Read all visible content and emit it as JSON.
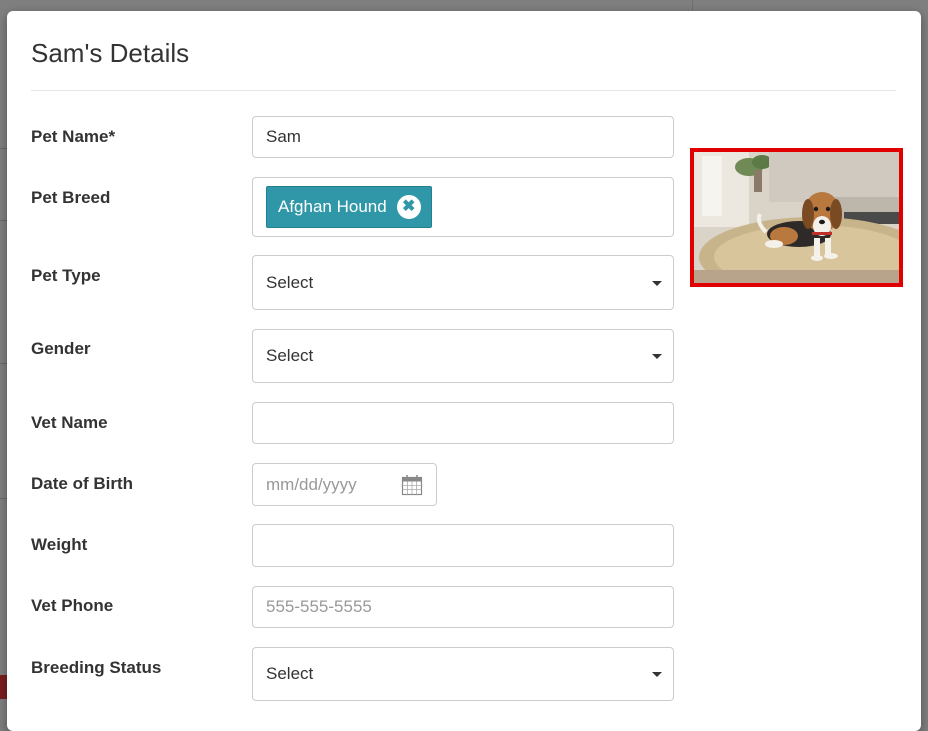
{
  "modal": {
    "title": "Sam's Details"
  },
  "fields": {
    "pet_name": {
      "label": "Pet Name*",
      "value": "Sam"
    },
    "pet_breed": {
      "label": "Pet Breed",
      "tags": [
        "Afghan Hound"
      ],
      "remove_glyph": "✖"
    },
    "pet_type": {
      "label": "Pet Type",
      "selected": "Select"
    },
    "gender": {
      "label": "Gender",
      "selected": "Select"
    },
    "vet_name": {
      "label": "Vet Name",
      "value": ""
    },
    "date_of_birth": {
      "label": "Date of Birth",
      "placeholder": "mm/dd/yyyy",
      "icon": "calendar-icon"
    },
    "weight": {
      "label": "Weight",
      "value": ""
    },
    "vet_phone": {
      "label": "Vet Phone",
      "placeholder": "555-555-5555"
    },
    "breeding_status": {
      "label": "Breeding Status",
      "selected": "Select"
    }
  },
  "photo": {
    "subject": "beagle lying on a rug",
    "border_color": "#e00000"
  },
  "colors": {
    "tag_bg": "#3097a8",
    "text": "#333333"
  }
}
